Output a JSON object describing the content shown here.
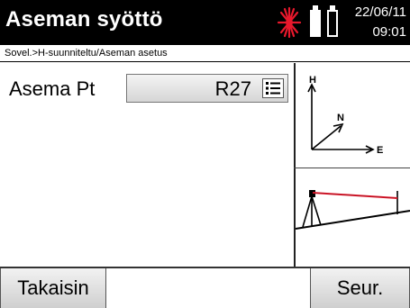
{
  "header": {
    "title": "Aseman syöttö",
    "date": "22/06/11",
    "time": "09:01",
    "icons": [
      "laser-icon",
      "battery-full-icon",
      "battery-empty-icon"
    ]
  },
  "breadcrumb": "Sovel.>H-suunniteltu/Aseman asetus",
  "form": {
    "station_label": "Asema Pt",
    "station_value": "R27"
  },
  "diagram": {
    "axis_h": "H",
    "axis_n": "N",
    "axis_e": "E"
  },
  "softkeys": {
    "back": "Takaisin",
    "middle": "",
    "next": "Seur."
  },
  "colors": {
    "laser": "#e8182c",
    "survey_line": "#e8182c"
  }
}
